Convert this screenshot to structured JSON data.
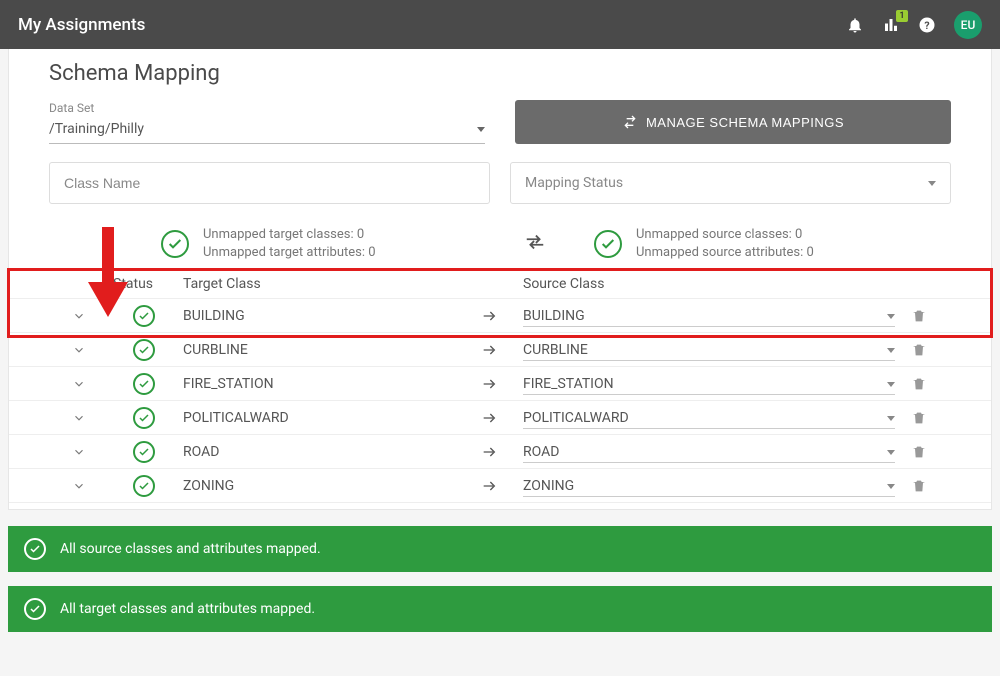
{
  "topbar": {
    "title": "My Assignments",
    "chartBadge": "1",
    "avatar": "EU"
  },
  "page": {
    "title": "Schema Mapping",
    "datasetLabel": "Data Set",
    "datasetValue": "/Training/Philly",
    "manageBtn": "MANAGE SCHEMA MAPPINGS",
    "classNamePlaceholder": "Class Name",
    "mappingStatusPlaceholder": "Mapping Status"
  },
  "stats": {
    "targetClasses": "Unmapped target classes: 0",
    "targetAttrs": "Unmapped target attributes: 0",
    "sourceClasses": "Unmapped source classes: 0",
    "sourceAttrs": "Unmapped source attributes: 0"
  },
  "table": {
    "hStatus": "Status",
    "hTarget": "Target Class",
    "hSource": "Source Class",
    "rows": [
      {
        "target": "BUILDING",
        "source": "BUILDING"
      },
      {
        "target": "CURBLINE",
        "source": "CURBLINE"
      },
      {
        "target": "FIRE_STATION",
        "source": "FIRE_STATION"
      },
      {
        "target": "POLITICALWARD",
        "source": "POLITICALWARD"
      },
      {
        "target": "ROAD",
        "source": "ROAD"
      },
      {
        "target": "ZONING",
        "source": "ZONING"
      }
    ]
  },
  "banners": {
    "source": "All source classes and attributes mapped.",
    "target": "All target classes and attributes mapped."
  }
}
